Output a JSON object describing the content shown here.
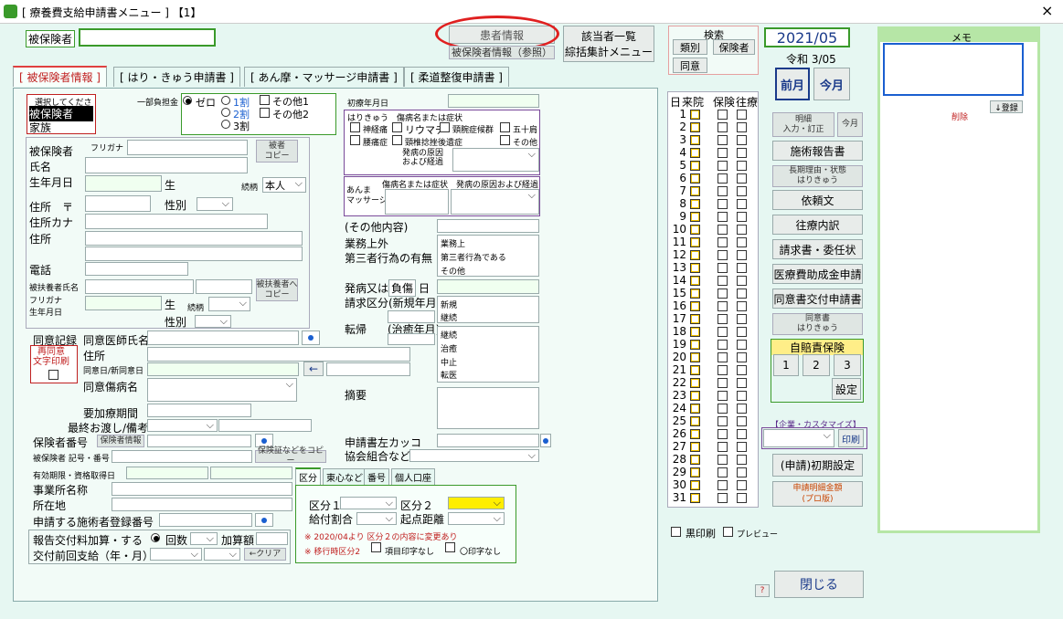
{
  "window": {
    "title": "[ 療養費支給申請書メニュー ]  【1】",
    "close": "×"
  },
  "top": {
    "insured_label": "被保険者",
    "patient_info": "患者情報",
    "insured_info_ref": "被保険者情報（参照）",
    "applicable_list": "該当者一覧",
    "summary_menu": "綜括集計メニュー",
    "search_title": "検索",
    "search_kind": "類別",
    "search_insurer": "保険者",
    "search_consent": "同意",
    "year_month": "2021/05",
    "reiwa": "令和 3/05",
    "prev_month": "前月",
    "this_month": "今月",
    "memo_title": "メモ",
    "memo_delete": "削除",
    "memo_register": "↓登録"
  },
  "tabs": [
    {
      "label": "[ 被保険者情報 ]"
    },
    {
      "label": "[ はり・きゅう申請書 ]"
    },
    {
      "label": "[ あん摩・マッサージ申請書 ]"
    },
    {
      "label": "[ 柔道整復申請書 ]"
    }
  ],
  "form": {
    "select_title": "選択してください",
    "select_options": [
      "被保険者",
      "家族"
    ],
    "burden": "一部負担金",
    "r_zero": "ゼロ",
    "r_1": "1割",
    "r_2": "2割",
    "r_3": "3割",
    "other1": "その他1",
    "other2": "その他2",
    "insured_person": "被保険者",
    "name": "氏名",
    "furigana": "フリガナ",
    "insured_copy": "被者\nコピー",
    "dob": "生年月日",
    "sei": "生",
    "relation": "続柄",
    "relation_val": "本人",
    "address_zip": "住所　〒",
    "gender": "性別",
    "address_kana": "住所カナ",
    "address": "住所",
    "phone": "電話",
    "dep_name": "被扶養者氏名",
    "dep_furigana": "フリガナ",
    "dep_dob": "生年月日",
    "dep_sei": "生",
    "dep_relation": "続柄",
    "dep_gender": "性別",
    "dep_copy": "被扶養者へ\nコピー",
    "first_visit": "初療年月日",
    "hk_title": "はりきゅう　傷病名または症状",
    "hk1": "神経痛",
    "hk2": "リウマチ",
    "hk3": "頸腕症候群",
    "hk4": "五十肩",
    "hk5": "腰痛症",
    "hk6": "頸椎捻挫後遺症",
    "hk7": "その他",
    "hk_cause": "発病の原因\nおよび経過",
    "am_label": "あんま\nマッサージ",
    "am_title": "傷病名または症状　発病の原因および経過",
    "other_content": "(その他内容)",
    "work": "業務上外",
    "third": "第三者行為の有無",
    "work_opts": [
      "業務上",
      "第三者行為である",
      "その他"
    ],
    "onset": "発病又は",
    "injury": "負傷",
    "day": "日",
    "claim_kind": "請求区分(新規年月)",
    "claim_opts": [
      "新規",
      "継続"
    ],
    "outcome": "転帰",
    "outcome2": "(治癒年月)",
    "outcome_opts": [
      "継続",
      "治癒",
      "中止",
      "転医"
    ],
    "consent_record": "同意記録",
    "doctor_name": "同意医師氏名",
    "reconsent": "再同意\n文字印刷",
    "c_address": "住所",
    "consent_date": "同意日/新同意日",
    "arrow": "←",
    "consent_disease": "同意傷病名",
    "care_period": "要加療期間",
    "last_handover": "最終お渡し/備考",
    "insurer_no": "保険者番号",
    "insurer_info": "保険者情報",
    "insured_symbol": "被保険者 記号・番号",
    "copy_card": "保険証などをコピー",
    "valid_period": "有効期限・資格取得日",
    "office_name": "事業所名称",
    "location": "所在地",
    "facility_no": "申請する施術者登録番号",
    "report_fee": "報告交付料加算・する",
    "times": "回数",
    "addition": "加算額",
    "prev_payment": "交付前回支給（年・月）",
    "clear": "←クリア",
    "remarks": "摘要",
    "bracket": "申請書左カッコ",
    "assoc": "協会組合など"
  },
  "kubun": {
    "tabs": [
      "区分",
      "東心など",
      "番号",
      "個人口座"
    ],
    "k1": "区分１",
    "k2": "区分２",
    "ratio": "給付割合",
    "distance": "起点距離",
    "note1": "※ 2020/04より 区分２の内容に変更あり",
    "note2": "※ 移行時区分2",
    "noitem": "項目印字なし",
    "nocircle": "〇印字なし"
  },
  "days": {
    "day_h": "日",
    "visit_h": "来院",
    "ins_h": "保険",
    "round_h": "往療",
    "list": [
      "1",
      "2",
      "3",
      "4",
      "5",
      "6",
      "7",
      "8",
      "9",
      "10",
      "11",
      "12",
      "13",
      "14",
      "15",
      "16",
      "17",
      "18",
      "19",
      "20",
      "21",
      "22",
      "23",
      "24",
      "25",
      "26",
      "27",
      "28",
      "29",
      "30",
      "31"
    ]
  },
  "right": {
    "details": "明細\n入力・訂正",
    "now": "今月",
    "treatment_report": "施術報告書",
    "long_reason": "長期理由・状態\nはりきゅう",
    "request_letter": "依頼文",
    "visit_detail": "往療内訳",
    "invoice": "請求書・委任状",
    "medical_aid": "医療費助成金申請",
    "consent_form": "同意書交付申請書",
    "consent_hk": "同意書\nはりきゅう",
    "jibai": "自賠責保険",
    "j1": "1",
    "j2": "2",
    "j3": "3",
    "settings": "設定",
    "enterprise": "【企業・カスタマイズ】",
    "print": "印刷",
    "init_settings": "(申請)初期設定",
    "detail_amount": "申請明細金額\n(プロ版)",
    "black_print": "黒印刷",
    "preview": "プレビュー",
    "help": "?",
    "close": "閉じる"
  },
  "colors": {
    "accent": "#e04040",
    "highlight": "#ffee00",
    "panel": "#b6e6a6"
  }
}
